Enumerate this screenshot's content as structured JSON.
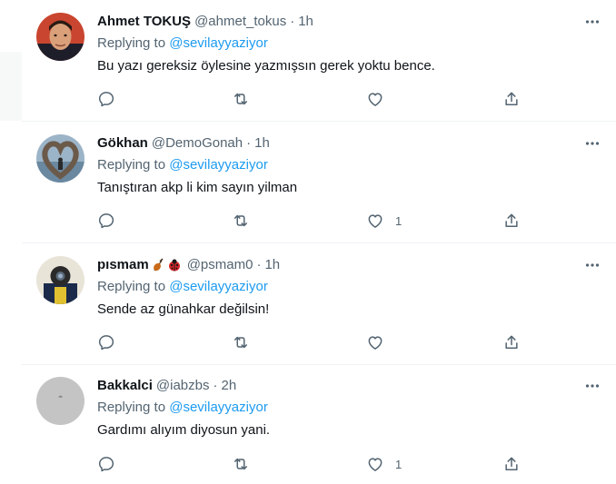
{
  "reply_prefix": "Replying to",
  "replies": [
    {
      "name": "Ahmet TOKUŞ",
      "handle": "@ahmet_tokus",
      "time": "1h",
      "replying_to": "@sevilayyaziyor",
      "text": "Bu yazı gereksiz öylesine yazmışsın gerek yoktu bence.",
      "like_count": "",
      "avatar": "man-portrait-avatar"
    },
    {
      "name": "Gökhan",
      "handle": "@DemoGonah",
      "time": "1h",
      "replying_to": "@sevilayyaziyor",
      "text": "Tanıştıran akp li kim sayın yilman",
      "like_count": "1",
      "avatar": "heart-sculpture-avatar"
    },
    {
      "name": "pısmam",
      "name_emoji": [
        "violin-emoji",
        "ladybug-emoji"
      ],
      "handle": "@psmam0",
      "time": "1h",
      "replying_to": "@sevilayyaziyor",
      "text": "Sende az günahkar değilsin!",
      "like_count": "",
      "avatar": "photographer-avatar"
    },
    {
      "name": "Bakkalci",
      "handle": "@iabzbs",
      "time": "2h",
      "replying_to": "@sevilayyaziyor",
      "text": "Gardımı alıyım diyosun yani.",
      "like_count": "1",
      "avatar": "grey-default-avatar"
    }
  ],
  "colors": {
    "accent": "#1d9bf0",
    "secondary_text": "#536471",
    "border": "#eff3f4"
  }
}
